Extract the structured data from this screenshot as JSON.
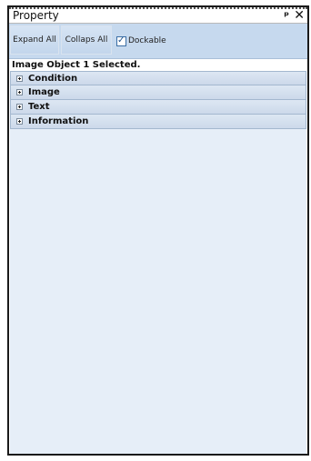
{
  "panel": {
    "title": "Property",
    "pin_icon": "pin-icon",
    "close_icon": "close-icon"
  },
  "toolbar": {
    "expand_all_label": "Expand All",
    "collapse_all_label": "Collaps All",
    "dockable_label": "Dockable",
    "dockable_checked": true
  },
  "status": {
    "selected_message": "Image Object 1 Selected."
  },
  "sections": [
    {
      "label": "Condition",
      "state": "collapsed"
    },
    {
      "label": "Image",
      "state": "collapsed"
    },
    {
      "label": "Text",
      "state": "collapsed"
    },
    {
      "label": "Information",
      "state": "collapsed"
    }
  ],
  "colors": {
    "toolbar_bg": "#c6d9ee",
    "panel_bg": "#e6eef8",
    "section_header_bg": "#ccd9ea"
  }
}
